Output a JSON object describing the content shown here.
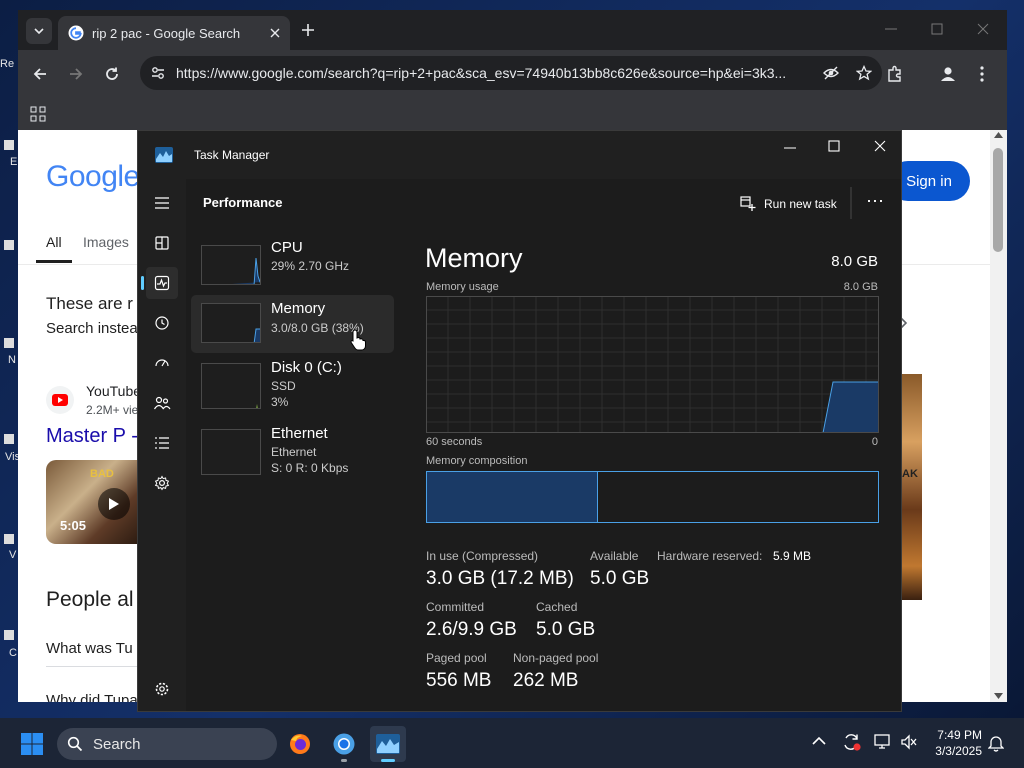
{
  "desktop": {
    "icon_labels": [
      "Re",
      "E",
      "N",
      "Vis",
      "V",
      "C"
    ]
  },
  "chrome": {
    "tab_title": "rip 2 pac - Google Search",
    "url": "https://www.google.com/search?q=rip+2+pac&sca_esv=74940b13bb8c626e&source=hp&ei=3k3...",
    "page": {
      "logo": "Google",
      "sign_in": "Sign in",
      "tab_all": "All",
      "tab_images": "Images",
      "notice_line1": "These are r",
      "notice_line2": "Search instea",
      "result_source": "YouTube",
      "result_meta": "2.2M+ vie",
      "result_title": "Master P -",
      "video_duration": "5:05",
      "people_also_ask": "People al",
      "question_1": "What was Tu",
      "question_2": "Why did Tupa",
      "video_overlay_text": "BAD",
      "side_image_text": "AK"
    }
  },
  "taskmanager": {
    "title": "Task Manager",
    "section": "Performance",
    "run_new_task": "Run new task",
    "more": "⋯",
    "items": [
      {
        "title": "CPU",
        "line1": "29% 2.70 GHz",
        "line2": ""
      },
      {
        "title": "Memory",
        "line1": "3.0/8.0 GB (38%)",
        "line2": ""
      },
      {
        "title": "Disk 0 (C:)",
        "line1": "SSD",
        "line2": "3%"
      },
      {
        "title": "Ethernet",
        "line1": "Ethernet",
        "line2": "S: 0 R: 0 Kbps"
      }
    ],
    "detail": {
      "heading": "Memory",
      "total": "8.0 GB",
      "usage_label": "Memory usage",
      "usage_max": "8.0 GB",
      "time_label": "60 seconds",
      "min_label": "0",
      "composition_label": "Memory composition",
      "composition_in_use_fraction": 0.38,
      "stats": {
        "in_use_label": "In use (Compressed)",
        "in_use_value": "3.0 GB (17.2 MB)",
        "available_label": "Available",
        "available_value": "5.0 GB",
        "hw_reserved_label": "Hardware reserved:",
        "hw_reserved_value": "5.9 MB",
        "committed_label": "Committed",
        "committed_value": "2.6/9.9 GB",
        "cached_label": "Cached",
        "cached_value": "5.0 GB",
        "paged_label": "Paged pool",
        "paged_value": "556 MB",
        "nonpaged_label": "Non-paged pool",
        "nonpaged_value": "262 MB"
      }
    }
  },
  "taskbar": {
    "search_label": "Search",
    "time": "7:49 PM",
    "date": "3/3/2025"
  },
  "colors": {
    "accent": "#60cdff",
    "memory_graph": "#4aa0e6",
    "memory_fill": "#1a3a66",
    "chrome_dark": "#202124",
    "google_blue": "#1a0dab"
  }
}
